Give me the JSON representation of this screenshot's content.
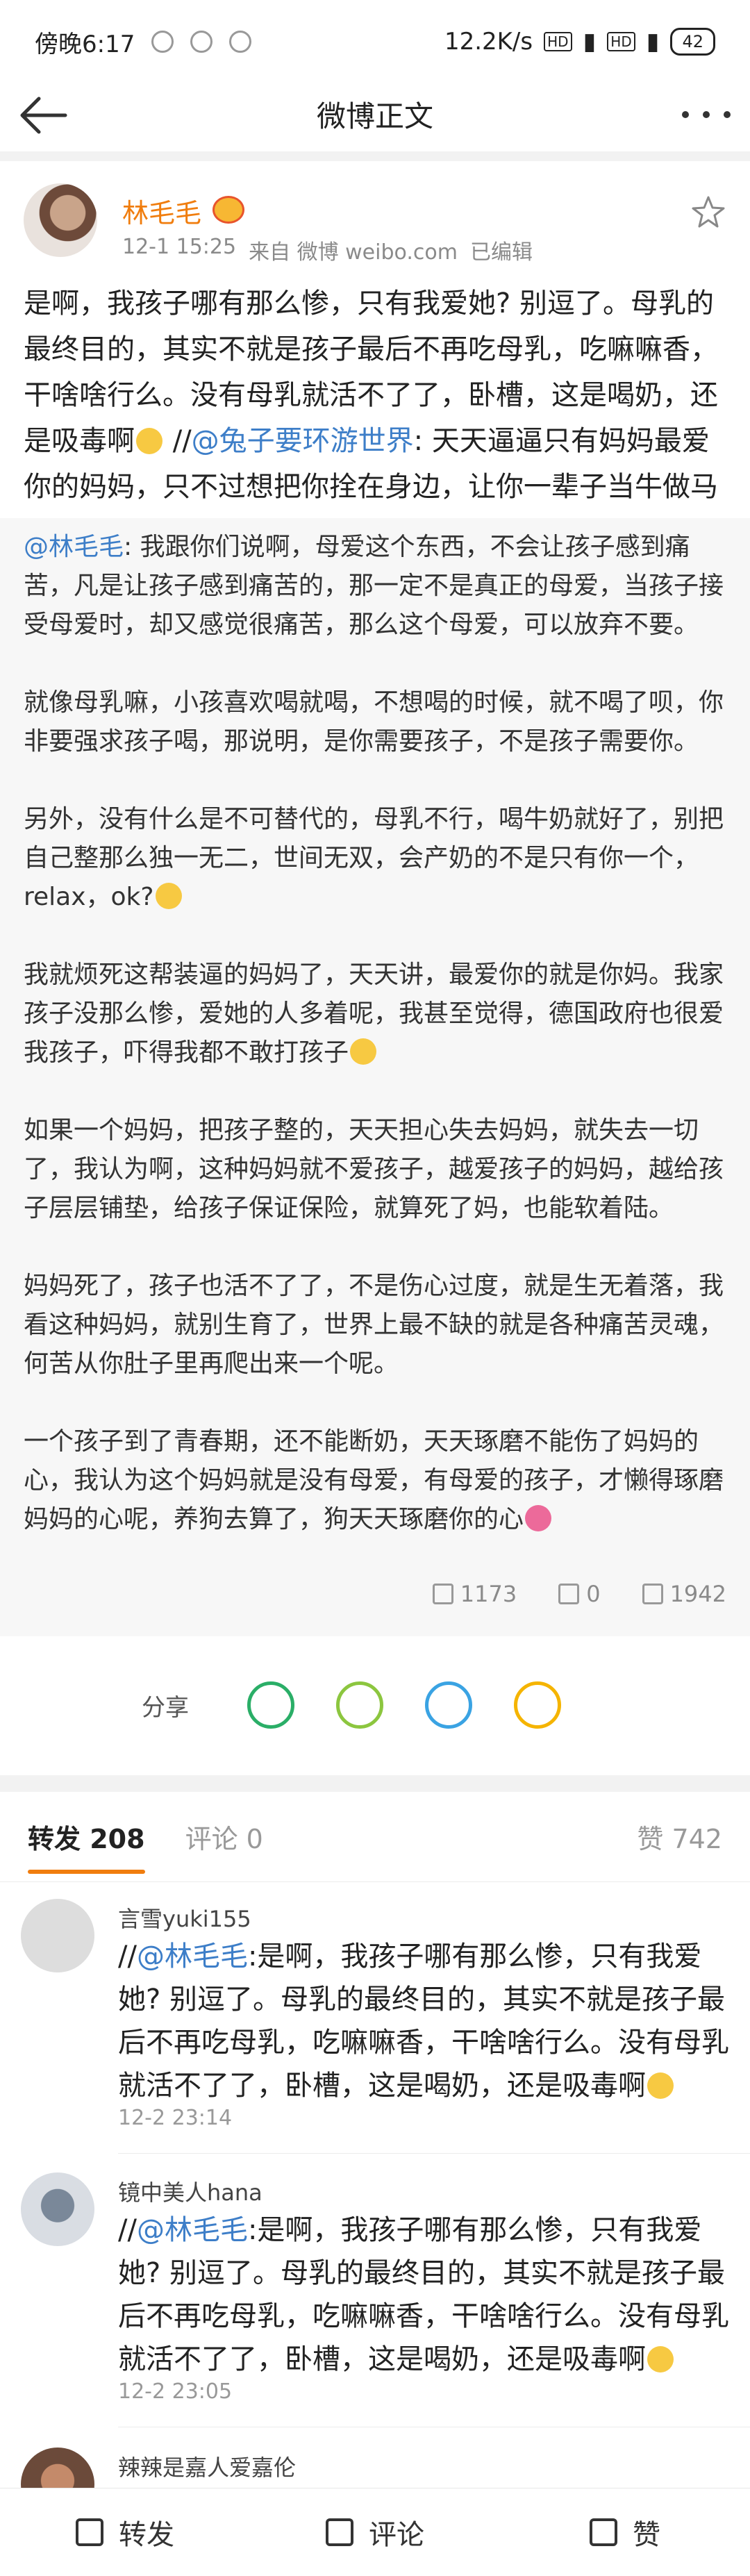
{
  "statusbar": {
    "time": "傍晚6:17",
    "speed": "12.2K/s",
    "battery": "42"
  },
  "nav": {
    "title": "微博正文"
  },
  "author": {
    "name": "林毛毛",
    "date": "12-1 15:25",
    "source": "来自 微博 weibo.com",
    "edited": "已编辑"
  },
  "post": {
    "text_a": "是啊，我孩子哪有那么惨，只有我爱她? 别逗了。母乳的最终目的，其实不就是孩子最后不再吃母乳，吃嘛嘛香，干啥啥行么。没有母乳就活不了了，卧槽，这是喝奶，还是吸毒啊",
    "sep": " //",
    "mention": "@兔子要环游世界",
    "text_b": ": 天天逼逼只有妈妈最爱你的妈妈，只不过想把你拴在身边，让你一辈子当牛做马"
  },
  "quoted": {
    "mention": "@林毛毛",
    "p1": ": 我跟你们说啊，母爱这个东西，不会让孩子感到痛苦，凡是让孩子感到痛苦的，那一定不是真正的母爱，当孩子接受母爱时，却又感觉很痛苦，那么这个母爱，可以放弃不要。",
    "p2": "就像母乳嘛，小孩喜欢喝就喝，不想喝的时候，就不喝了呗，你非要强求孩子喝，那说明，是你需要孩子，不是孩子需要你。",
    "p3": "另外，没有什么是不可替代的，母乳不行，喝牛奶就好了，别把自己整那么独一无二，世间无双，会产奶的不是只有你一个，relax，ok?",
    "p4": "我就烦死这帮装逼的妈妈了，天天讲，最爱你的就是你妈。我家孩子没那么惨，爱她的人多着呢，我甚至觉得，德国政府也很爱我孩子，吓得我都不敢打孩子",
    "p5": "如果一个妈妈，把孩子整的，天天担心失去妈妈，就失去一切了，我认为啊，这种妈妈就不爱孩子，越爱孩子的妈妈，越给孩子层层铺垫，给孩子保证保险，就算死了妈，也能软着陆。",
    "p6": "妈妈死了，孩子也活不了了，不是伤心过度，就是生无着落，我看这种妈妈，就别生育了，世界上最不缺的就是各种痛苦灵魂，何苦从你肚子里再爬出来一个呢。",
    "p7": "一个孩子到了青春期，还不能断奶，天天琢磨不能伤了妈妈的心，我认为这个妈妈就是没有母爱，有母爱的孩子，才懒得琢磨妈妈的心呢，养狗去算了，狗天天琢磨你的心",
    "reposts": "1173",
    "comments": "0",
    "likes": "1942"
  },
  "share": {
    "label": "分享"
  },
  "tabs": {
    "repost": "转发 208",
    "comment": "评论 0",
    "like": "赞 742"
  },
  "comments": [
    {
      "user": "言雪yuki155",
      "prefix": "//",
      "mention": "@林毛毛",
      "text": ":是啊，我孩子哪有那么惨，只有我爱她? 别逗了。母乳的最终目的，其实不就是孩子最后不再吃母乳，吃嘛嘛香，干啥啥行么。没有母乳就活不了了，卧槽，这是喝奶，还是吸毒啊",
      "time": "12-2 23:14"
    },
    {
      "user": "镜中美人hana",
      "prefix": "//",
      "mention": "@林毛毛",
      "text": ":是啊，我孩子哪有那么惨，只有我爱她? 别逗了。母乳的最终目的，其实不就是孩子最后不再吃母乳，吃嘛嘛香，干啥啥行么。没有母乳就活不了了，卧槽，这是喝奶，还是吸毒啊",
      "time": "12-2 23:05"
    },
    {
      "user": "辣辣是嘉人爱嘉伦"
    }
  ],
  "bottom": {
    "repost": "转发",
    "comment": "评论",
    "like": "赞"
  },
  "colors": {
    "accent": "#f07d0e",
    "link": "#3d7ec8"
  }
}
